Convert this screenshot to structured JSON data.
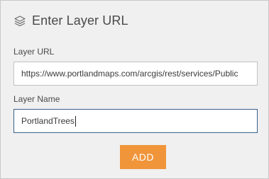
{
  "panel": {
    "title": "Enter Layer URL",
    "header_icon": "layers-icon"
  },
  "form": {
    "url_label": "Layer URL",
    "url_value": "https://www.portlandmaps.com/arcgis/rest/services/Public",
    "name_label": "Layer Name",
    "name_value": "PortlandTrees",
    "add_button_label": "ADD"
  },
  "colors": {
    "panel_bg": "#f0f0f0",
    "accent_button": "#f0953a",
    "focused_border": "#3a5f8a"
  }
}
